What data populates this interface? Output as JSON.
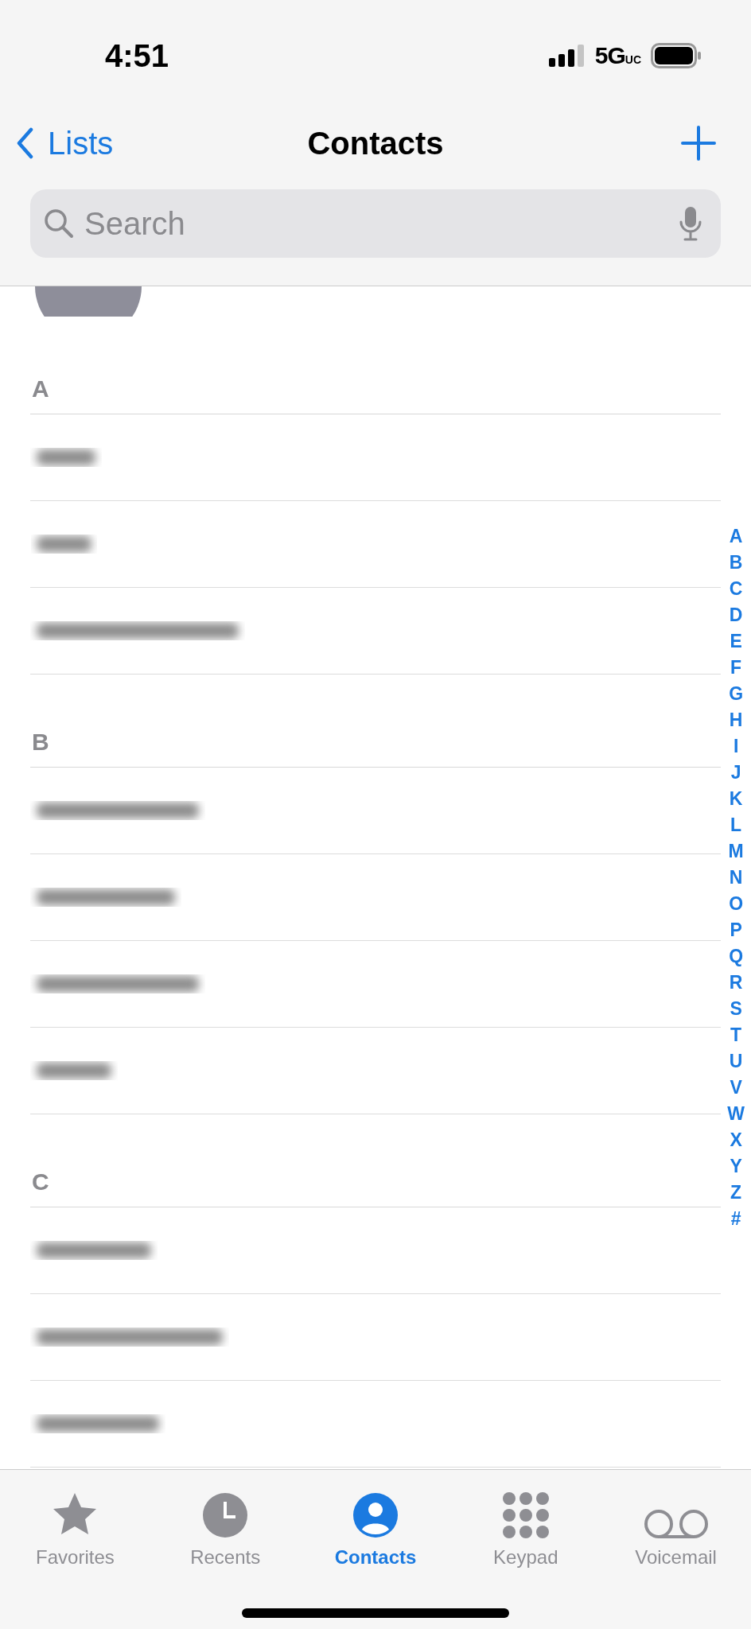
{
  "status_bar": {
    "time": "4:51",
    "network": "5G",
    "network_suffix": "UC"
  },
  "nav": {
    "back_label": "Lists",
    "title": "Contacts"
  },
  "search": {
    "placeholder": "Search"
  },
  "sections": [
    {
      "letter": "A",
      "rows": [
        {
          "blurred": true
        },
        {
          "blurred": true
        },
        {
          "blurred": true
        }
      ]
    },
    {
      "letter": "B",
      "rows": [
        {
          "blurred": true
        },
        {
          "blurred": true
        },
        {
          "blurred": true
        },
        {
          "blurred": true
        }
      ]
    },
    {
      "letter": "C",
      "rows": [
        {
          "blurred": true
        },
        {
          "blurred": true
        },
        {
          "blurred": true
        }
      ]
    }
  ],
  "index": [
    "A",
    "B",
    "C",
    "D",
    "E",
    "F",
    "G",
    "H",
    "I",
    "J",
    "K",
    "L",
    "M",
    "N",
    "O",
    "P",
    "Q",
    "R",
    "S",
    "T",
    "U",
    "V",
    "W",
    "X",
    "Y",
    "Z",
    "#"
  ],
  "tabs": [
    {
      "label": "Favorites",
      "kind": "star",
      "selected": false
    },
    {
      "label": "Recents",
      "kind": "clock",
      "selected": false
    },
    {
      "label": "Contacts",
      "kind": "person",
      "selected": true
    },
    {
      "label": "Keypad",
      "kind": "keypad",
      "selected": false
    },
    {
      "label": "Voicemail",
      "kind": "voicemail",
      "selected": false
    }
  ]
}
